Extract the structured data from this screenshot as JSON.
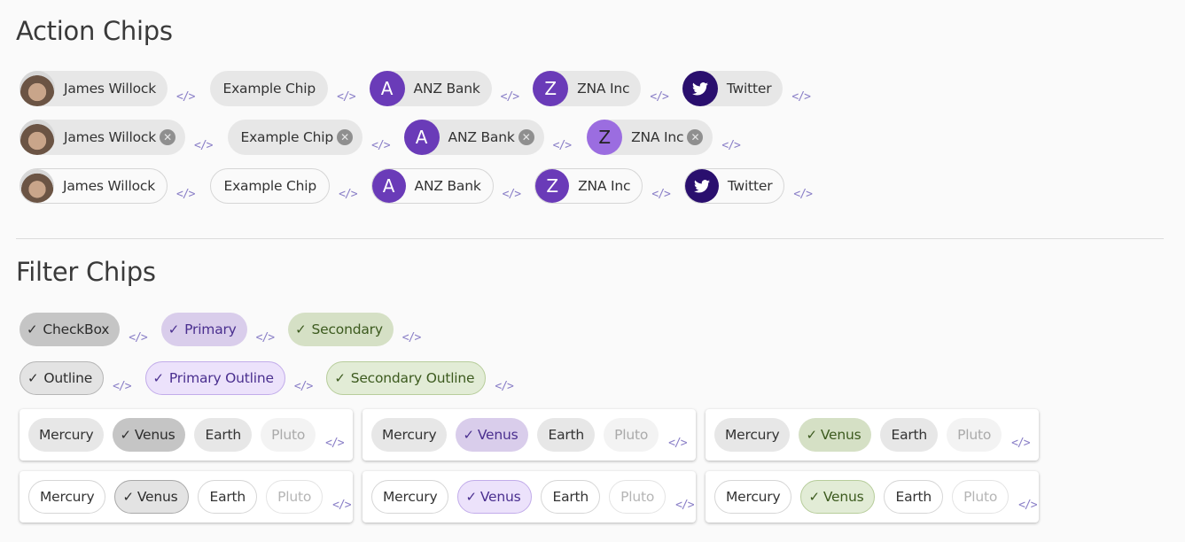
{
  "action_section": {
    "title": "Action Chips",
    "chips": {
      "james": "James Willock",
      "example": "Example Chip",
      "anz": "ANZ Bank",
      "anz_initial": "A",
      "zna": "ZNA Inc",
      "zna_initial": "Z",
      "twitter": "Twitter"
    },
    "close_glyph": "✕",
    "code_glyph": "</>"
  },
  "filter_section": {
    "title": "Filter Chips",
    "row1": [
      "CheckBox",
      "Primary",
      "Secondary"
    ],
    "row2": [
      "Outline",
      "Primary Outline",
      "Secondary Outline"
    ],
    "check_glyph": "✓",
    "planets": [
      "Mercury",
      "Venus",
      "Earth",
      "Pluto"
    ],
    "selected_planet": "Venus",
    "disabled_planet": "Pluto"
  },
  "colors": {
    "primary_avatar": "#6a3bb8",
    "primary_avatar_light": "#9b6de0",
    "twitter_avatar": "#2a0f6e",
    "code_icon": "#8a7fc7",
    "primary_fill": "#d9cdeb",
    "secondary_fill": "#d5e0c5"
  }
}
